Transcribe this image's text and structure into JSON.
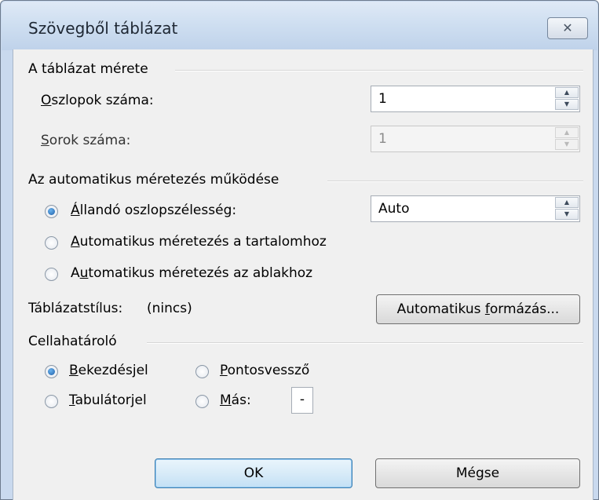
{
  "dialog": {
    "title": "Szövegből táblázat",
    "close_glyph": "✕"
  },
  "table_size": {
    "group_label": "A táblázat mérete",
    "columns_label_u": "O",
    "columns_label_rest": "szlopok száma:",
    "columns_value": "1",
    "rows_label_u": "S",
    "rows_label_rest": "orok száma:",
    "rows_value": "1"
  },
  "autofit": {
    "group_label": "Az automatikus méretezés működése",
    "fixed_u": "Á",
    "fixed_rest": "llandó oszlopszélesség:",
    "fixed_value": "Auto",
    "contents_u": "A",
    "contents_rest": "utomatikus méretezés a tartalomhoz",
    "window_pre": "A",
    "window_u": "u",
    "window_rest": "tomatikus méretezés az ablakhoz",
    "selected": "fixed"
  },
  "table_style": {
    "label": "Táblázatstílus:",
    "value": "(nincs)",
    "button_pre": "Automatikus ",
    "button_u": "f",
    "button_rest": "ormázás..."
  },
  "separator": {
    "group_label": "Cellahatároló",
    "paragraph_u": "B",
    "paragraph_rest": "ekezdésjel",
    "semicolon_u": "P",
    "semicolon_rest": "ontosvessző",
    "tab_u": "T",
    "tab_rest": "abulátorjel",
    "other_u": "M",
    "other_rest": "ás:",
    "other_value": "-",
    "selected": "paragraph"
  },
  "buttons": {
    "ok": "OK",
    "cancel": "Mégse"
  }
}
